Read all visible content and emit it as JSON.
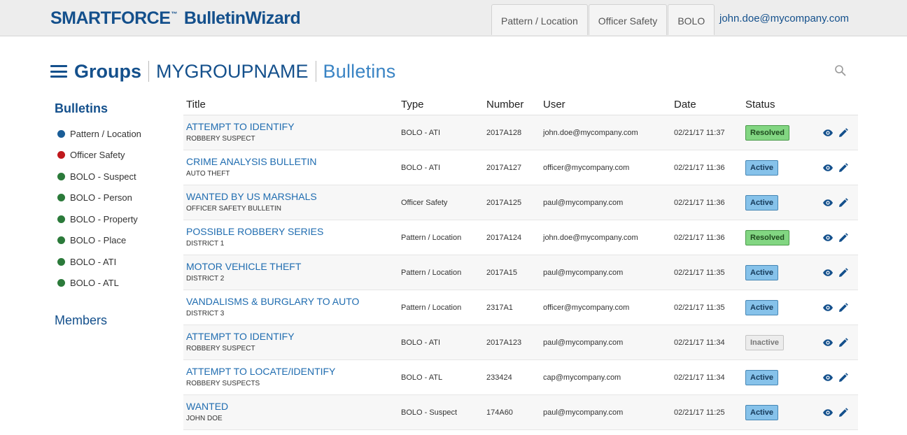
{
  "header": {
    "brand_name": "SMARTFORCE",
    "brand_tm": "™",
    "brand_app": "BulletinWizard",
    "tabs": [
      {
        "label": "Pattern / Location"
      },
      {
        "label": "Officer Safety"
      },
      {
        "label": "BOLO"
      }
    ],
    "user_email": "john.doe@mycompany.com"
  },
  "heading": {
    "groups": "Groups",
    "group_name": "MYGROUPNAME",
    "section": "Bulletins"
  },
  "sidebar": {
    "heading": "Bulletins",
    "items": [
      {
        "label": "Pattern / Location",
        "color": "#1a5d97"
      },
      {
        "label": "Officer Safety",
        "color": "#c0181d"
      },
      {
        "label": "BOLO - Suspect",
        "color": "#2b7a3a"
      },
      {
        "label": "BOLO - Person",
        "color": "#2b7a3a"
      },
      {
        "label": "BOLO - Property",
        "color": "#2b7a3a"
      },
      {
        "label": "BOLO - Place",
        "color": "#2b7a3a"
      },
      {
        "label": "BOLO - ATI",
        "color": "#2b7a3a"
      },
      {
        "label": "BOLO - ATL",
        "color": "#2b7a3a"
      }
    ],
    "members": "Members"
  },
  "table": {
    "columns": [
      "Title",
      "Type",
      "Number",
      "User",
      "Date",
      "Status"
    ],
    "rows": [
      {
        "title": "ATTEMPT TO IDENTIFY",
        "subtitle": "ROBBERY SUSPECT",
        "type": "BOLO - ATI",
        "number": "2017A128",
        "user": "john.doe@mycompany.com",
        "date": "02/21/17 11:37",
        "status": "Resolved"
      },
      {
        "title": "CRIME ANALYSIS BULLETIN",
        "subtitle": "AUTO THEFT",
        "type": "BOLO - ATI",
        "number": "2017A127",
        "user": "officer@mycompany.com",
        "date": "02/21/17 11:36",
        "status": "Active"
      },
      {
        "title": "WANTED BY US MARSHALS",
        "subtitle": "OFFICER SAFETY BULLETIN",
        "type": "Officer Safety",
        "number": "2017A125",
        "user": "paul@mycompany.com",
        "date": "02/21/17 11:36",
        "status": "Active"
      },
      {
        "title": "POSSIBLE ROBBERY SERIES",
        "subtitle": "DISTRICT 1",
        "type": "Pattern / Location",
        "number": "2017A124",
        "user": "john.doe@mycompany.com",
        "date": "02/21/17 11:36",
        "status": "Resolved"
      },
      {
        "title": "MOTOR VEHICLE THEFT",
        "subtitle": "DISTRICT 2",
        "type": "Pattern / Location",
        "number": "2017A15",
        "user": "paul@mycompany.com",
        "date": "02/21/17 11:35",
        "status": "Active"
      },
      {
        "title": "VANDALISMS & BURGLARY TO AUTO",
        "subtitle": "DISTRICT 3",
        "type": "Pattern / Location",
        "number": "2317A1",
        "user": "officer@mycompany.com",
        "date": "02/21/17 11:35",
        "status": "Active"
      },
      {
        "title": "ATTEMPT TO IDENTIFY",
        "subtitle": "ROBBERY SUSPECT",
        "type": "BOLO - ATI",
        "number": "2017A123",
        "user": "paul@mycompany.com",
        "date": "02/21/17 11:34",
        "status": "Inactive"
      },
      {
        "title": "ATTEMPT TO LOCATE/IDENTIFY",
        "subtitle": "ROBBERY SUSPECTS",
        "type": "BOLO - ATL",
        "number": "233424",
        "user": "cap@mycompany.com",
        "date": "02/21/17 11:34",
        "status": "Active"
      },
      {
        "title": "WANTED",
        "subtitle": "JOHN DOE",
        "type": "BOLO - Suspect",
        "number": "174A60",
        "user": "paul@mycompany.com",
        "date": "02/21/17 11:25",
        "status": "Active"
      }
    ]
  },
  "icons": {
    "view": "eye-icon",
    "edit": "pencil-icon",
    "search": "search-icon",
    "menu": "hamburger-icon"
  },
  "colors": {
    "brand": "#14508c",
    "link": "#1f6cb0",
    "resolved": "#82d682",
    "active": "#86c2ea",
    "inactive": "#ececec"
  }
}
